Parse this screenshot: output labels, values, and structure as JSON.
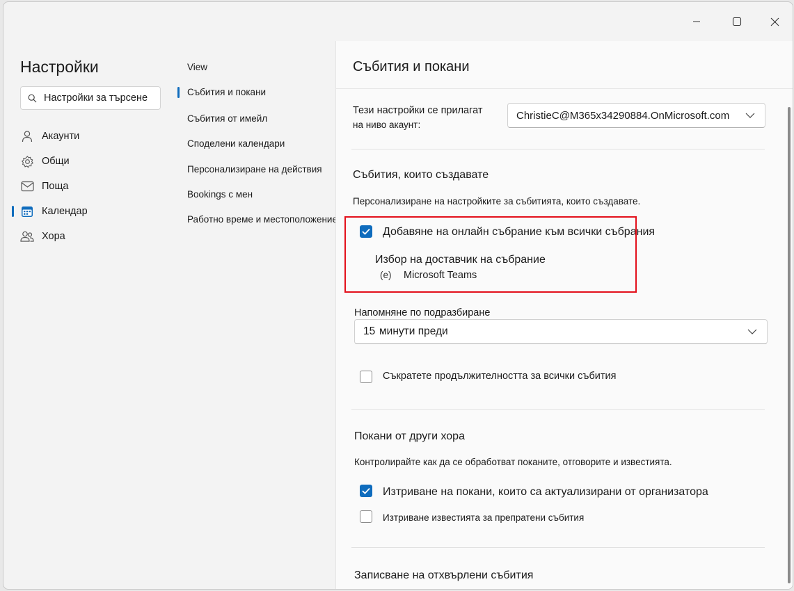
{
  "window": {
    "controls": [
      "minimize-icon",
      "maximize-icon",
      "close-icon"
    ]
  },
  "sidebar": {
    "title": "Настройки",
    "search_text": "Настройки за търсене",
    "items": [
      {
        "label": "Акаунти",
        "icon": "person-icon"
      },
      {
        "label": "Общи",
        "icon": "gear-icon"
      },
      {
        "label": "Поща",
        "icon": "mail-icon"
      },
      {
        "label": "Календар",
        "icon": "calendar-icon",
        "selected": true
      },
      {
        "label": "Хора",
        "icon": "people-icon"
      }
    ]
  },
  "subnav": {
    "items": [
      {
        "label": "View"
      },
      {
        "label": "Събития и покани",
        "selected": true
      },
      {
        "label": "Събития от имейл"
      },
      {
        "label": "Споделени календари"
      },
      {
        "label": "Персонализиране на действия"
      },
      {
        "label": "Bookings с мен"
      },
      {
        "label": "Работно време и местоположение"
      }
    ]
  },
  "main": {
    "title": "Събития и покани",
    "account_scope": {
      "line1": "Тези настройки се прилагат",
      "line2": "на ниво акаунт:",
      "account": "ChristieC@M365x34290884.OnMicrosoft.com"
    },
    "events_you_create": {
      "heading": "Събития, които създавате",
      "description": "Персонализиране на настройките за събитията, които създавате.",
      "add_online_meeting": {
        "label": "Добавяне на онлайн събрание към всички събрания",
        "checked": true
      },
      "provider_label": "Избор на доставчик на събрание",
      "provider_icon_text": "(e)",
      "provider_name": "Microsoft Teams",
      "reminder_label": "Напомняне по подразбиране",
      "reminder_number": "15",
      "reminder_text": "минути преди",
      "shorten_duration": {
        "label": "Съкратете продължителността за всички събития",
        "checked": false
      }
    },
    "invitations": {
      "heading": "Покани от други хора",
      "description": "Контролирайте как да се обработват поканите, отговорите и известията.",
      "delete_updated": {
        "label": "Изтриване на покани, които са актуализирани от организатора",
        "checked": true
      },
      "delete_forwarded": {
        "label": "Изтриване известията за препратени събития",
        "checked": false
      }
    },
    "declined_heading": "Записване на отхвърлени събития"
  },
  "colors": {
    "accent": "#0f6cbd",
    "highlight": "#e3101b"
  }
}
